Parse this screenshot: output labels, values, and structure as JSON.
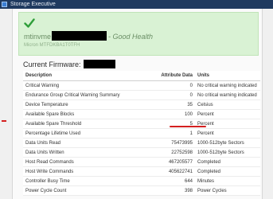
{
  "titlebar": {
    "title": "Storage Executive"
  },
  "health": {
    "drive_name": "mtinvme",
    "status": "- Good Health",
    "model": "Micron MTFDKBA1T0TFH",
    "status_color": "#6b8f66",
    "card_color": "#d9f2d4"
  },
  "firmware": {
    "label": "Current Firmware:"
  },
  "table": {
    "headers": [
      "Description",
      "Attribute Data",
      "Units"
    ],
    "rows": [
      {
        "desc": "Critical Warning",
        "data": "0",
        "units": "No critical warning indicated"
      },
      {
        "desc": "Endurance Group Critical Warning Summary",
        "data": "0",
        "units": "No critical warning indicated"
      },
      {
        "desc": "Device Temperature",
        "data": "35",
        "units": "Celsius"
      },
      {
        "desc": "Available Spare Blocks",
        "data": "100",
        "units": "Percent"
      },
      {
        "desc": "Available Spare Threshold",
        "data": "5",
        "units": "Percent"
      },
      {
        "desc": "Percentage Lifetime Used",
        "data": "1",
        "units": "Percent"
      },
      {
        "desc": "Data Units Read",
        "data": "75473995",
        "units": "1000-512byte Sectors"
      },
      {
        "desc": "Data Units Written",
        "data": "22752598",
        "units": "1000-512byte Sectors"
      },
      {
        "desc": "Host Read Commands",
        "data": "467205577",
        "units": "Completed"
      },
      {
        "desc": "Host Write Commands",
        "data": "405622741",
        "units": "Completed"
      },
      {
        "desc": "Controller Busy Time",
        "data": "644",
        "units": "Minutes"
      },
      {
        "desc": "Power Cycle Count",
        "data": "398",
        "units": "Power Cycles"
      }
    ]
  },
  "annotation_color": "#d42020"
}
